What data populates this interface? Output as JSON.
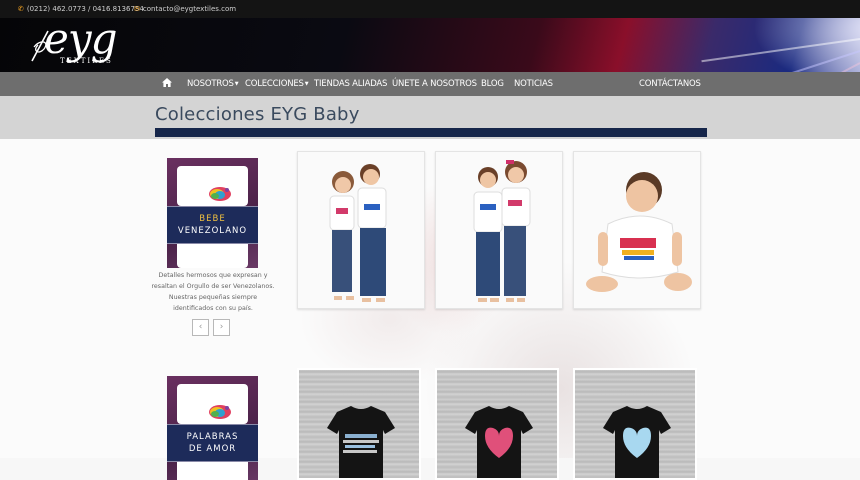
{
  "contact": {
    "phone": "(0212) 462.0773 / 0416.8136754",
    "email": "contacto@eygtextiles.com"
  },
  "brand": {
    "logo_text": "eyg",
    "logo_sub": "TEXTILES"
  },
  "nav": {
    "home_icon": "home-icon",
    "items": [
      "NOSOTROS",
      "COLECCIONES",
      "TIENDAS ALIADAS",
      "ÚNETE A NOSOTROS",
      "BLOG",
      "NOTICIAS"
    ],
    "contact": "CONTÁCTANOS"
  },
  "page": {
    "title": "Colecciones EYG Baby"
  },
  "collections": [
    {
      "badge_line1": "BEBE",
      "badge_line2": "VENEZOLANO",
      "description": "Detalles hermosos que expresan y resaltan el Orgullo de ser Venezolanos. Nuestras pequeñas siempre identificados con su país."
    },
    {
      "badge_line1": "PALABRAS",
      "badge_line2": "DE AMOR"
    }
  ],
  "carousel": {
    "prev": "‹",
    "next": "›"
  },
  "colors": {
    "accent_bar": "#16264a",
    "nav_bg": "#6e6e6e",
    "title_text": "#3a4a5e",
    "contact_icon": "#f0a020"
  }
}
